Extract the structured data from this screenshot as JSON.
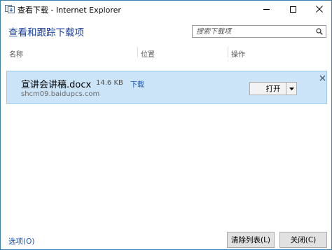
{
  "window": {
    "title": "查看下载 - Internet Explorer"
  },
  "header": {
    "heading": "查看和跟踪下载项",
    "search_placeholder": "搜索下载项"
  },
  "columns": {
    "name": "名称",
    "location": "位置",
    "actions": "操作"
  },
  "downloads": [
    {
      "file_name": "宣讲会讲稿.docx",
      "size": "14.6 KB",
      "type_link": "下载",
      "source": "shcm09.baidupcs.com",
      "open_label": "打开"
    }
  ],
  "footer": {
    "options_link": "选项(O)",
    "clear_list_label": "清除列表(L)",
    "close_label": "关闭(C)"
  },
  "colors": {
    "accent": "#1a3f9b",
    "selected_row": "#cce4f7",
    "link": "#1a55b4"
  },
  "icons": {
    "app": "ie-download-icon",
    "search": "search-icon",
    "dropdown": "chevron-down-icon",
    "dismiss": "close-icon"
  }
}
